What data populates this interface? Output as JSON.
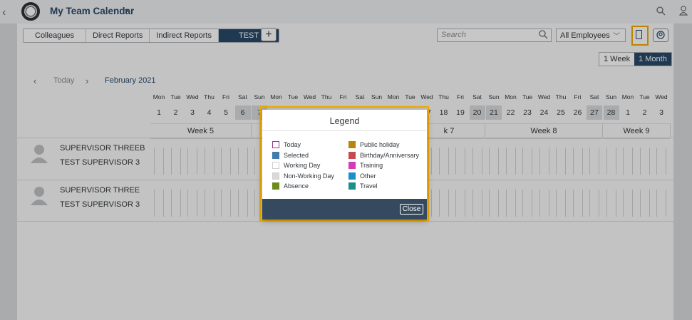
{
  "shell": {
    "back": "‹",
    "title": "My Team Calendar",
    "caret": "▾"
  },
  "toolbar": {
    "tabs": [
      "Colleagues",
      "Direct Reports",
      "Indirect Reports",
      "TEST"
    ],
    "add": "+",
    "search_placeholder": "Search",
    "employee_filter": "All Employees"
  },
  "view": {
    "week": "1 Week",
    "month": "1 Month"
  },
  "nav": {
    "prev": "‹",
    "today": "Today",
    "next": "›",
    "month": "February 2021"
  },
  "days": {
    "names": [
      "Mon",
      "Tue",
      "Wed",
      "Thu",
      "Fri",
      "Sat",
      "Sun",
      "Mon",
      "Tue",
      "Wed",
      "Thu",
      "Fri",
      "Sat",
      "Sun",
      "Mon",
      "Tue",
      "Wed",
      "Thu",
      "Fri",
      "Sat",
      "Sun",
      "Mon",
      "Tue",
      "Wed",
      "Thu",
      "Fri",
      "Sat",
      "Sun",
      "Mon",
      "Tue",
      "Wed"
    ],
    "visible_numbers": [
      {
        "n": "1",
        "col": 0
      },
      {
        "n": "2",
        "col": 1
      },
      {
        "n": "3",
        "col": 2
      },
      {
        "n": "4",
        "col": 3
      },
      {
        "n": "5",
        "col": 4
      },
      {
        "n": "6",
        "col": 5,
        "we": true
      },
      {
        "n": "7",
        "col": 6,
        "we": true
      },
      {
        "n": "17",
        "col": 16
      },
      {
        "n": "18",
        "col": 17
      },
      {
        "n": "19",
        "col": 18
      },
      {
        "n": "20",
        "col": 19,
        "we": true
      },
      {
        "n": "21",
        "col": 20,
        "we": true
      },
      {
        "n": "22",
        "col": 21
      },
      {
        "n": "23",
        "col": 22
      },
      {
        "n": "24",
        "col": 23
      },
      {
        "n": "25",
        "col": 24
      },
      {
        "n": "26",
        "col": 25
      },
      {
        "n": "27",
        "col": 26,
        "we": true
      },
      {
        "n": "28",
        "col": 27,
        "we": true
      },
      {
        "n": "1",
        "col": 28
      },
      {
        "n": "2",
        "col": 29
      },
      {
        "n": "3",
        "col": 30
      }
    ]
  },
  "weeks": [
    "Week 5",
    "Week 6",
    "k 7",
    "Week 8",
    "Week 9"
  ],
  "employees": [
    {
      "name": "SUPERVISOR THREEB",
      "role": "TEST SUPERVISOR 3"
    },
    {
      "name": "SUPERVISOR THREE",
      "role": "TEST SUPERVISOR 3"
    }
  ],
  "legend": {
    "title": "Legend",
    "left": [
      {
        "label": "Today",
        "color": "#ffffff",
        "border": "#a0338a"
      },
      {
        "label": "Selected",
        "color": "#427cac",
        "border": "#427cac"
      },
      {
        "label": "Working Day",
        "color": "#ffffff",
        "border": "#d0d0d0"
      },
      {
        "label": "Non-Working Day",
        "color": "#d9d9d9",
        "border": "#d0d0d0"
      },
      {
        "label": "Absence",
        "color": "#6e8b1d",
        "border": "#6e8b1d"
      }
    ],
    "right": [
      {
        "label": "Public holiday",
        "color": "#b8860b",
        "border": "#b8860b"
      },
      {
        "label": "Birthday/Anniversary",
        "color": "#c94a4a",
        "border": "#c94a4a"
      },
      {
        "label": "Training",
        "color": "#d63bb6",
        "border": "#d63bb6"
      },
      {
        "label": "Other",
        "color": "#1a8fc9",
        "border": "#1a8fc9"
      },
      {
        "label": "Travel",
        "color": "#1b8f8a",
        "border": "#1b8f8a"
      }
    ],
    "close": "Close"
  }
}
